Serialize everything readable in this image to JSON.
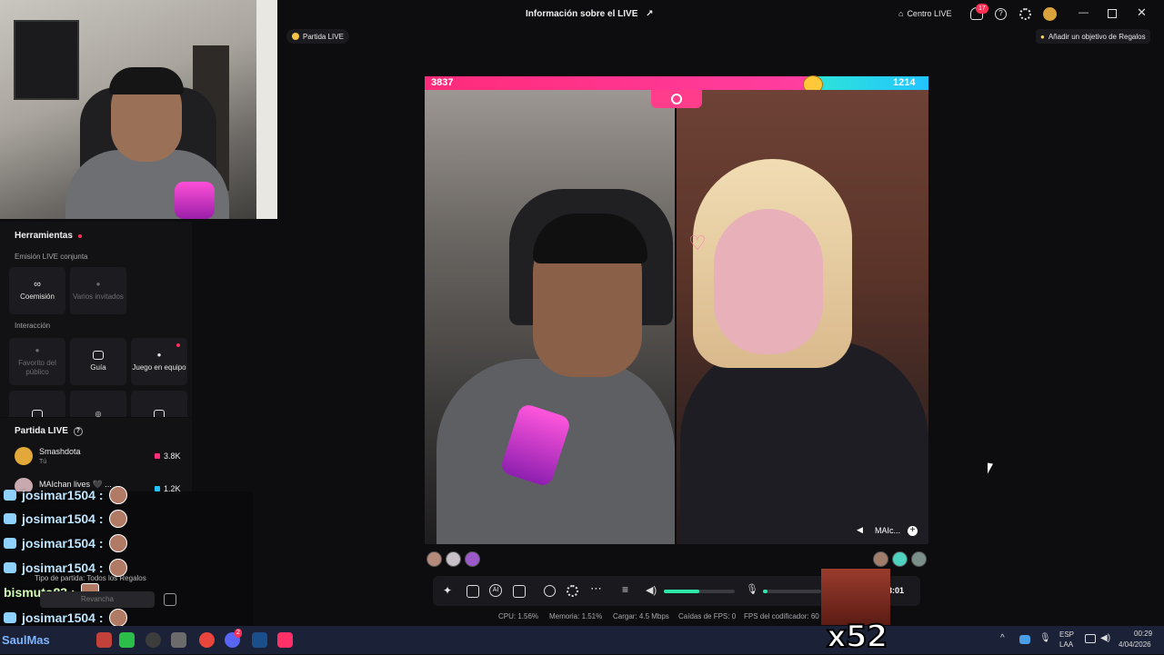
{
  "topbar": {
    "title": "Información sobre el LIVE",
    "centro_live": "Centro LIVE",
    "notif_count": "17",
    "match_pill": "Partida LIVE",
    "gift_goal": "Añadir un objetivo de Regalos"
  },
  "tools": {
    "title": "Herramientas",
    "cohost_section": "Emisión LIVE conjunta",
    "comision": "Coemisión",
    "varios": "Varios invitados",
    "interaction_section": "Interacción",
    "favorito": "Favorito del público",
    "guia": "Guía",
    "juego": "Juego en equipo"
  },
  "match": {
    "title": "Partida LIVE",
    "players": [
      {
        "name": "Smashdota",
        "sub": "Tú",
        "score": "3.8K"
      },
      {
        "name": "MAIchan lives 🖤 ...",
        "sub": "",
        "score": "1.2K"
      }
    ],
    "type_label": "Tipo de partida: Todos los Regalos",
    "rematch": "Revancha"
  },
  "battle": {
    "left_score": "3837",
    "right_score": "1214",
    "left_share": 0.76,
    "right_name": "MAIc...",
    "colors": {
      "left": "#ff2b7a",
      "right": "#23c3ff"
    }
  },
  "controls": {
    "timer": "3:01",
    "volume_level": 0.5
  },
  "stats": {
    "cpu": "CPU: 1.56%",
    "mem": "Memoria: 1.51%",
    "upload": "Cargar: 4.5 Mbps",
    "drops": "Caídas de FPS: 0",
    "encoder": "FPS del codificador: 60"
  },
  "chat": [
    {
      "user": "josimar1504 :"
    },
    {
      "user": "josimar1504 :"
    },
    {
      "user": "josimar1504 :"
    },
    {
      "user": "josimar1504 :"
    },
    {
      "user": "bismuto83 :"
    },
    {
      "user": "josimar1504 :"
    }
  ],
  "overlay": {
    "multiplier": "x52",
    "watermark": "SaulMas"
  },
  "taskbar": {
    "lang": "ESP",
    "lang2": "LAA",
    "time": "00:29",
    "date": "4/04/2026",
    "discord_badge": "2"
  }
}
